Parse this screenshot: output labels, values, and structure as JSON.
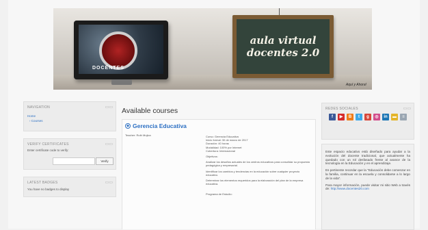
{
  "banner": {
    "board_line1": "aula virtual",
    "board_line2": "docentes 2.0",
    "signature": "Aquí y Ahora!"
  },
  "navigation": {
    "title": "NAVIGATION",
    "home": "Home",
    "courses": "Courses"
  },
  "verify": {
    "title": "VERIFY CERTIFICATES",
    "label": "Enter certificate code to verify:",
    "input_value": "",
    "button": "Verify"
  },
  "badges": {
    "title": "LATEST BADGES",
    "empty": "You have no badges to display"
  },
  "main": {
    "title": "Available courses",
    "course": {
      "name": "Gerencia Educativa",
      "teacher": "Teacher: Ruth Mujica",
      "lines": [
        "Curso: Gerencia Educativa",
        "Inicio formal: 30 de marzo de 2017",
        "Duración: 40 horas",
        "Modalidad: 100% por Internet",
        "Cobertura: Internacional"
      ],
      "objectives_heading": "Objetivos:",
      "objectives": [
        "Analizar los desafíos actuales de los centros educativos para consolidar su propuesta pedagógica y empresarial.",
        "Identificar los cambios y tendencias en la educación sobre cualquier proyecto educativo.",
        "Determinar los elementos requeridos para la elaboración del plan de la empresa educativa."
      ],
      "program": "Programa de Estudio:"
    }
  },
  "social": {
    "title": "REDES SOCIALES",
    "icons": [
      {
        "name": "facebook-icon",
        "glyph": "f",
        "color": "#3b5998"
      },
      {
        "name": "youtube-icon",
        "glyph": "▶",
        "color": "#d62b2b"
      },
      {
        "name": "blogger-icon",
        "glyph": "B",
        "color": "#ef7d1a"
      },
      {
        "name": "twitter-icon",
        "glyph": "t",
        "color": "#3fa9e8"
      },
      {
        "name": "google-plus-icon",
        "glyph": "g",
        "color": "#d8473a"
      },
      {
        "name": "instagram-icon",
        "glyph": "◎",
        "color": "#d24d8b"
      },
      {
        "name": "linkedin-icon",
        "glyph": "in",
        "color": "#1c76b5"
      },
      {
        "name": "folder-icon",
        "glyph": "▬",
        "color": "#e4b52a"
      },
      {
        "name": "document-icon",
        "glyph": "≡",
        "color": "#9aa6b2"
      }
    ]
  },
  "info": {
    "p1": "Este espacio educativo está diseñado para ayudar a la evolución del docente tradicional, que actualmente ha quedado con un rol desfasado frente al avance de la tecnología en la Educación y en el aprendizaje.",
    "p2": "Es pertinente recordar que la \"Educación debe comenzar en la familia, continuar en la escuela y consolidarse a lo largo de la vida\".",
    "p3_text": "Para mayor información, puede visitar mi sitio Web a través de:",
    "p3_link": "http://www.docentes20.com"
  }
}
